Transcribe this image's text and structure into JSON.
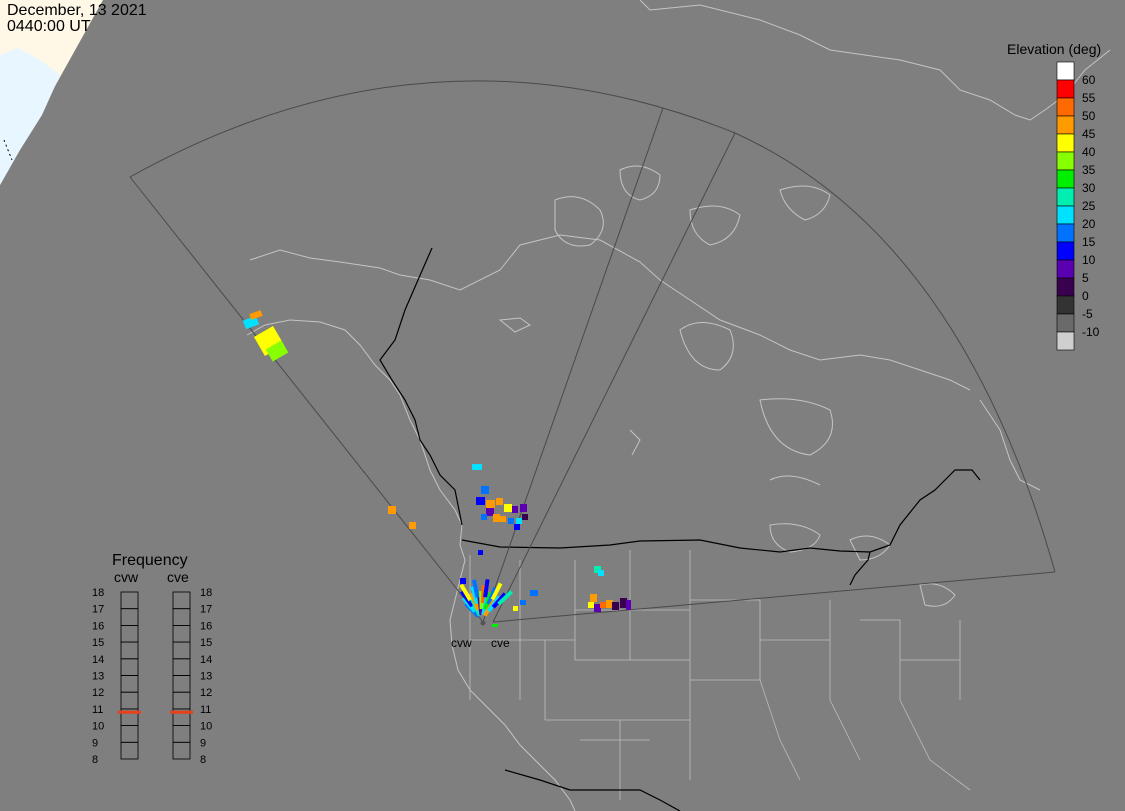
{
  "header": {
    "date": "December, 13 2021",
    "time": "0440:00 UT"
  },
  "colorbar": {
    "title": "Elevation (deg)",
    "labels": [
      "60",
      "55",
      "50",
      "45",
      "40",
      "35",
      "30",
      "25",
      "20",
      "15",
      "10",
      "5",
      "0",
      "-5",
      "-10"
    ],
    "colors": [
      "#ffffff",
      "#ff0000",
      "#ff6a00",
      "#ff9a00",
      "#ffff00",
      "#88ff00",
      "#00ee00",
      "#00eeb0",
      "#00e0ff",
      "#0072ff",
      "#0000ff",
      "#5a00b0",
      "#3a0050",
      "#333333",
      "#6a6a6a",
      "#cfcfcf"
    ]
  },
  "frequency": {
    "title": "Frequency",
    "radars": [
      {
        "name": "cvw",
        "frequency_mhz": 10.8
      },
      {
        "name": "cve",
        "frequency_mhz": 10.8
      }
    ],
    "scale": [
      "18",
      "17",
      "16",
      "15",
      "14",
      "13",
      "12",
      "11",
      "10",
      "9",
      "8"
    ],
    "marker_color": "#e8401a"
  },
  "radar_sites": [
    {
      "name": "cvw"
    },
    {
      "name": "cve"
    }
  ],
  "map": {
    "background": "#7f7f7f",
    "boundary_color": "#c4c4c4",
    "border_color": "#000000",
    "fov_color": "#4a4a4a",
    "daylight_color": "#fff8e1",
    "daylight_color_2": "#e8f6ff"
  }
}
